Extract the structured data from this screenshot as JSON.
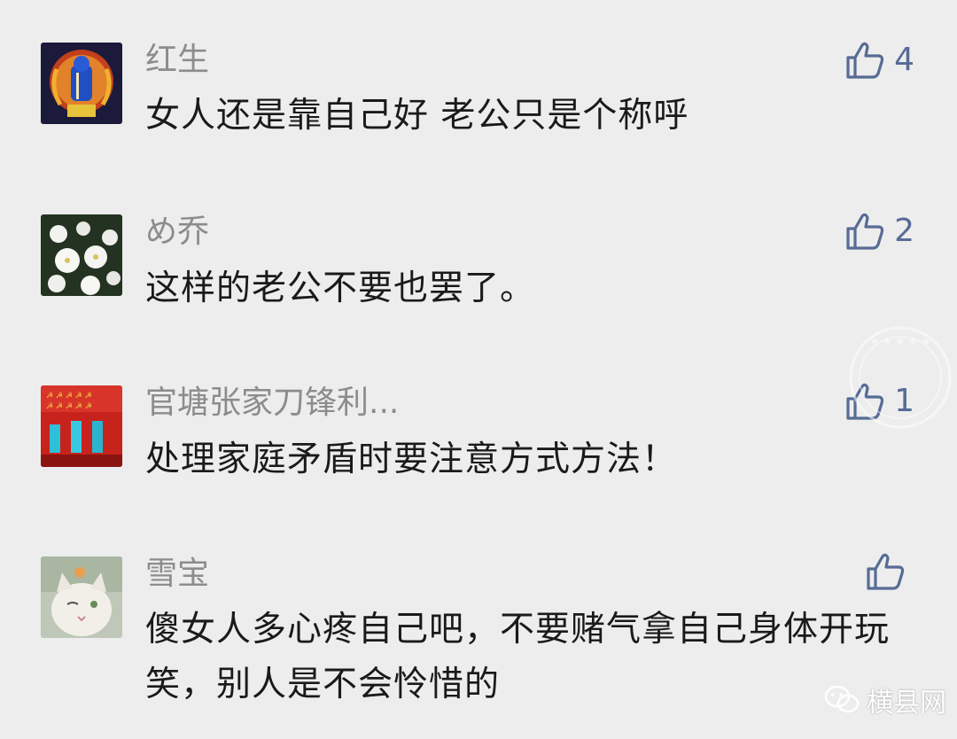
{
  "comments": [
    {
      "name": "红生",
      "content": "女人还是靠自己好 老公只是个称呼",
      "likes": "4"
    },
    {
      "name": "め乔",
      "content": "这样的老公不要也罢了。",
      "likes": "2"
    },
    {
      "name": "官塘张家刀锋利...",
      "content": "处理家庭矛盾时要注意方式方法！",
      "likes": "1"
    },
    {
      "name": "雪宝",
      "content": "傻女人多心疼自己吧，不要赌气拿自己身体开玩笑，别人是不会怜惜的",
      "likes": ""
    }
  ],
  "watermark": {
    "seal_text": "横县网",
    "bottom_text": "横县网"
  },
  "colors": {
    "background": "#ededed",
    "name": "#8c8c8c",
    "content": "#1a1a1a",
    "like_accent": "#576b95"
  },
  "icons": {
    "like": "thumbs-up-icon",
    "wechat": "wechat-icon"
  }
}
